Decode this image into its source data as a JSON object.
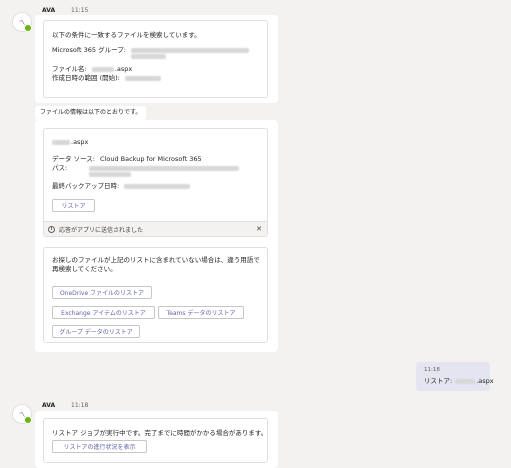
{
  "bot_message_1": {
    "sender": "AVA",
    "time": "11:15",
    "search_card": {
      "intro": "以下の条件に一致するファイルを検索しています。",
      "group_label": "Microsoft 365 グループ:",
      "file_label": "ファイル名:",
      "file_suffix": ".aspx",
      "date_label": "作成日時の範囲 (開始):"
    },
    "info_text": "ファイルの情報は以下のとおりです。",
    "result_card": {
      "file_suffix": ".aspx",
      "source_label": "データ ソース:",
      "source_value": "Cloud Backup for Microsoft 365",
      "path_label": "パス:",
      "last_backup_label": "最終バックアップ日時:",
      "restore_button": "リストア",
      "status_text": "応答がアプリに送信されました"
    },
    "options_card": {
      "text": "お探しのファイルが上記のリストに含まれていない場合は、違う用語で再検索してください。",
      "onedrive_button": "OneDrive ファイルのリストア",
      "exchange_button": "Exchange アイテムのリストア",
      "teams_button": "Teams データのリストア",
      "group_button": "グループ データのリストア"
    }
  },
  "user_message": {
    "time": "11:18",
    "label": "リストア:",
    "suffix": ".aspx"
  },
  "bot_message_2": {
    "sender": "AVA",
    "time": "11:18",
    "text": "リストア ジョブが実行中です。完了までに時間がかかる場合があります。",
    "status_button": "リストアの進行状況を表示"
  }
}
